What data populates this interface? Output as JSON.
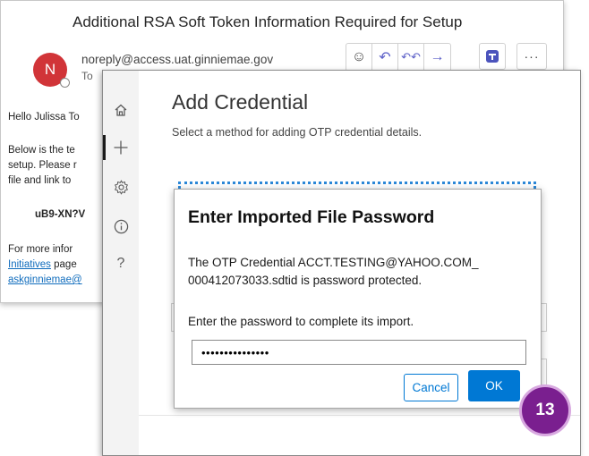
{
  "email": {
    "subject": "Additional RSA Soft Token Information Required for Setup",
    "avatar_initial": "N",
    "sender": "noreply@access.uat.ginniemae.gov",
    "to_label": "To",
    "body_lines": [
      "Hello Julissa To",
      "Below is the te",
      "setup. Please r",
      "file and link to",
      "uB9-XN?V",
      "For more infor",
      "Initiatives",
      " page",
      "askginniemae@"
    ],
    "actions": {
      "emoji": "☺",
      "reply": "↶",
      "reply_all": "↶↶",
      "forward": "→",
      "more": "···"
    }
  },
  "app": {
    "sidebar": {
      "icons": [
        "home-icon",
        "add-icon",
        "settings-icon",
        "info-icon",
        "help-icon"
      ],
      "glyphs": {
        "home": "⌂",
        "add": "+",
        "settings": "⚙",
        "info": "ⓘ",
        "help": "?"
      }
    },
    "title": "Add Credential",
    "subtitle": "Select a method for adding OTP credential details."
  },
  "dialog": {
    "title": "Enter Imported File Password",
    "message_line1": "The OTP Credential ACCT.TESTING@YAHOO.COM_",
    "message_line2": "000412073033.sdtid is password protected.",
    "prompt": "Enter the password to complete its import.",
    "password_value": "•••••••••••••••",
    "cancel_label": "Cancel",
    "ok_label": "OK"
  },
  "badge": {
    "number": "13"
  },
  "colors": {
    "accent": "#0078d4",
    "avatar": "#d13438",
    "badge": "#7a1f8f",
    "teams": "#4b53bc"
  }
}
